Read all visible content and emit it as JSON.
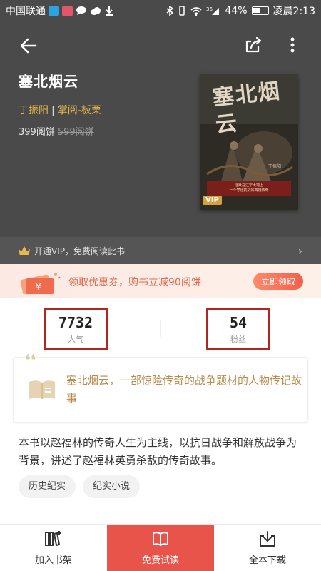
{
  "status_bar": {
    "carrier": "中国联通",
    "signal": "36",
    "battery": "44%",
    "time": "凌晨2:13",
    "icons": [
      "video-app-icon",
      "circle-app-icon",
      "chat-icon",
      "cloud-icon",
      "download-icon",
      "bluetooth-icon",
      "vibrate-icon",
      "wifi-icon",
      "signal-icon",
      "battery-icon"
    ]
  },
  "header": {
    "title": "塞北烟云",
    "author": "丁振阳",
    "publisher": "掌阅-板栗",
    "price": "399阅饼",
    "original_price": "599阅饼",
    "cover": {
      "title": "塞北烟云",
      "author": "丁振阳",
      "band_line1": "活跃在辽宁大地上",
      "band_line2": "一个悲壮抗战的英雄传奇",
      "badge": "VIP"
    }
  },
  "vip_strip": {
    "text": "开通VIP，免费阅读此书"
  },
  "coupon": {
    "text": "领取优惠券，购书立减90阅饼",
    "button": "立即领取"
  },
  "stats": [
    {
      "value": "7732",
      "label": "人气"
    },
    {
      "value": "54",
      "label": "粉丝"
    }
  ],
  "summary": {
    "text": "塞北烟云，一部惊险传奇的战争题材的人物传记故事"
  },
  "description": "本书以赵福林的传奇人生为主线，以抗日战争和解放战争为背景，讲述了赵福林英勇杀敌的传奇故事。",
  "tags": [
    "历史纪实",
    "纪实小说"
  ],
  "bottom_bar": {
    "add_shelf": "加入书架",
    "free_trial": "免费试读",
    "download_all": "全本下载"
  },
  "colors": {
    "header_bg": "#4a4a4a",
    "accent_gold": "#e8b84a",
    "primary_red": "#e9544a",
    "highlight_box": "#b3261e"
  }
}
